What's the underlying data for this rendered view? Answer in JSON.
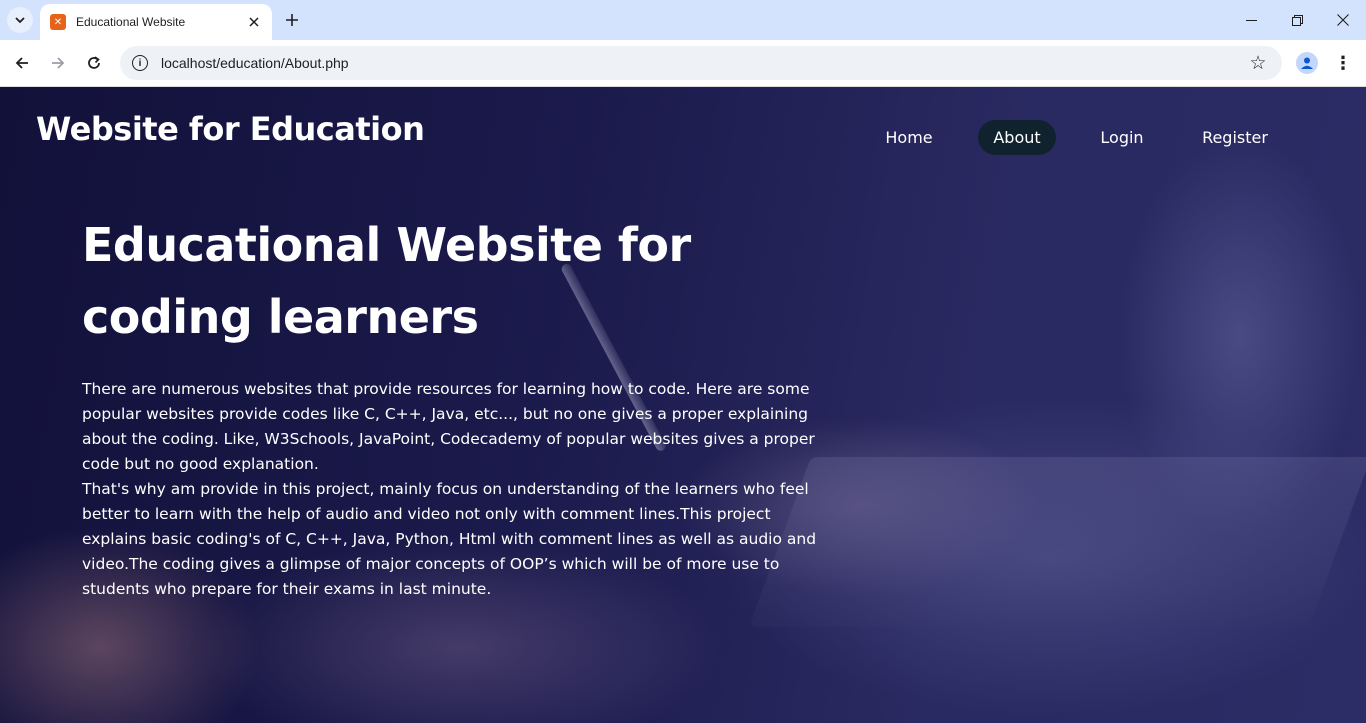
{
  "browser": {
    "tab_title": "Educational Website",
    "url": "localhost/education/About.php"
  },
  "site": {
    "title": "Website for Education",
    "nav": [
      {
        "label": "Home",
        "active": false
      },
      {
        "label": "About",
        "active": true
      },
      {
        "label": "Login",
        "active": false
      },
      {
        "label": "Register",
        "active": false
      }
    ]
  },
  "hero": {
    "heading_line1": "Educational Website for",
    "heading_line2": "coding learners",
    "paragraph1": "There are numerous websites that provide resources for learning how to code. Here are some popular websites provide codes like C, C++, Java, etc..., but no one gives a proper explaining about the coding. Like, W3Schools, JavaPoint, Codecademy of popular websites gives a proper code but no good explanation.",
    "paragraph2": "That's why am provide in this project, mainly focus on understanding of the learners who feel better to learn with the help of audio and video not only with comment lines.This project explains basic coding's of C, C++, Java, Python, Html with comment lines as well as audio and video.The coding gives a glimpse of major concepts of OOP’s which will be of more use to students who prepare for their exams in last minute."
  },
  "colors": {
    "chrome_bg": "#d3e3fd",
    "active_nav_bg": "#10222e",
    "page_overlay": "#1b1a4c"
  }
}
